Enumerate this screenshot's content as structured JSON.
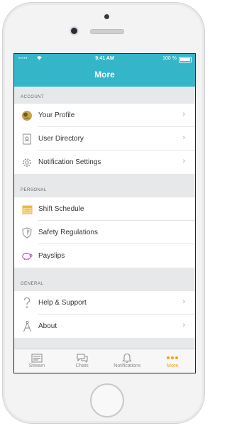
{
  "status_bar": {
    "signal": "•••••",
    "time": "9:41 AM",
    "battery": "100 %"
  },
  "nav": {
    "title": "More"
  },
  "sections": [
    {
      "header": "ACCOUNT",
      "items": [
        {
          "label": "Your Profile",
          "icon": "avatar-icon",
          "chevron": true
        },
        {
          "label": "User Directory",
          "icon": "directory-icon",
          "chevron": true
        },
        {
          "label": "Notification Settings",
          "icon": "gear-icon",
          "chevron": true
        }
      ]
    },
    {
      "header": "PERSONAL",
      "items": [
        {
          "label": "Shift Schedule",
          "icon": "calendar-icon",
          "chevron": false
        },
        {
          "label": "Safety Regulations",
          "icon": "shield-icon",
          "chevron": false
        },
        {
          "label": "Payslips",
          "icon": "piggy-bank-icon",
          "chevron": false
        }
      ]
    },
    {
      "header": "GENERAL",
      "items": [
        {
          "label": "Help & Support",
          "icon": "question-icon",
          "chevron": true
        },
        {
          "label": "About",
          "icon": "compass-icon",
          "chevron": true
        }
      ]
    }
  ],
  "tabbar": [
    {
      "label": "Stream",
      "icon": "stream-icon"
    },
    {
      "label": "Chats",
      "icon": "chat-bubble-icon"
    },
    {
      "label": "Notifications",
      "icon": "bell-icon"
    },
    {
      "label": "More",
      "icon": "more-dots-icon",
      "active": true
    }
  ],
  "colors": {
    "accent": "#35b5c8",
    "active_tab": "#f0a020",
    "section_bg": "#e6e8ea"
  }
}
